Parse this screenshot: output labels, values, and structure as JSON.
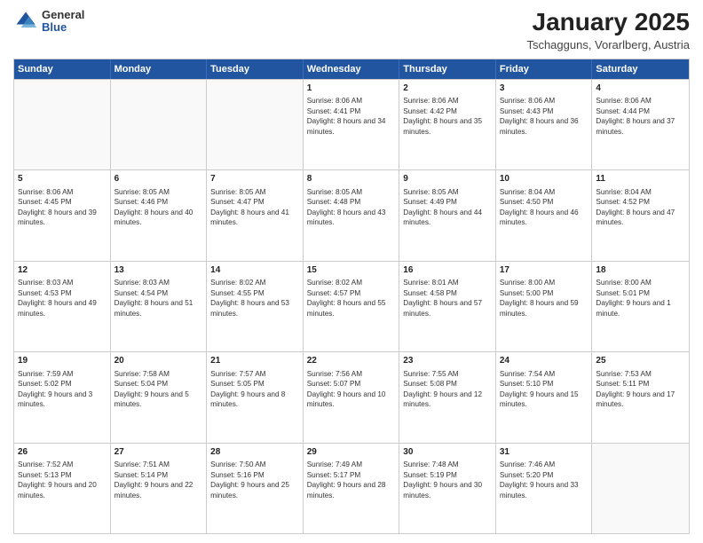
{
  "logo": {
    "general": "General",
    "blue": "Blue"
  },
  "title": "January 2025",
  "location": "Tschagguns, Vorarlberg, Austria",
  "weekdays": [
    "Sunday",
    "Monday",
    "Tuesday",
    "Wednesday",
    "Thursday",
    "Friday",
    "Saturday"
  ],
  "weeks": [
    [
      {
        "day": "",
        "sunrise": "",
        "sunset": "",
        "daylight": ""
      },
      {
        "day": "",
        "sunrise": "",
        "sunset": "",
        "daylight": ""
      },
      {
        "day": "",
        "sunrise": "",
        "sunset": "",
        "daylight": ""
      },
      {
        "day": "1",
        "sunrise": "Sunrise: 8:06 AM",
        "sunset": "Sunset: 4:41 PM",
        "daylight": "Daylight: 8 hours and 34 minutes."
      },
      {
        "day": "2",
        "sunrise": "Sunrise: 8:06 AM",
        "sunset": "Sunset: 4:42 PM",
        "daylight": "Daylight: 8 hours and 35 minutes."
      },
      {
        "day": "3",
        "sunrise": "Sunrise: 8:06 AM",
        "sunset": "Sunset: 4:43 PM",
        "daylight": "Daylight: 8 hours and 36 minutes."
      },
      {
        "day": "4",
        "sunrise": "Sunrise: 8:06 AM",
        "sunset": "Sunset: 4:44 PM",
        "daylight": "Daylight: 8 hours and 37 minutes."
      }
    ],
    [
      {
        "day": "5",
        "sunrise": "Sunrise: 8:06 AM",
        "sunset": "Sunset: 4:45 PM",
        "daylight": "Daylight: 8 hours and 39 minutes."
      },
      {
        "day": "6",
        "sunrise": "Sunrise: 8:05 AM",
        "sunset": "Sunset: 4:46 PM",
        "daylight": "Daylight: 8 hours and 40 minutes."
      },
      {
        "day": "7",
        "sunrise": "Sunrise: 8:05 AM",
        "sunset": "Sunset: 4:47 PM",
        "daylight": "Daylight: 8 hours and 41 minutes."
      },
      {
        "day": "8",
        "sunrise": "Sunrise: 8:05 AM",
        "sunset": "Sunset: 4:48 PM",
        "daylight": "Daylight: 8 hours and 43 minutes."
      },
      {
        "day": "9",
        "sunrise": "Sunrise: 8:05 AM",
        "sunset": "Sunset: 4:49 PM",
        "daylight": "Daylight: 8 hours and 44 minutes."
      },
      {
        "day": "10",
        "sunrise": "Sunrise: 8:04 AM",
        "sunset": "Sunset: 4:50 PM",
        "daylight": "Daylight: 8 hours and 46 minutes."
      },
      {
        "day": "11",
        "sunrise": "Sunrise: 8:04 AM",
        "sunset": "Sunset: 4:52 PM",
        "daylight": "Daylight: 8 hours and 47 minutes."
      }
    ],
    [
      {
        "day": "12",
        "sunrise": "Sunrise: 8:03 AM",
        "sunset": "Sunset: 4:53 PM",
        "daylight": "Daylight: 8 hours and 49 minutes."
      },
      {
        "day": "13",
        "sunrise": "Sunrise: 8:03 AM",
        "sunset": "Sunset: 4:54 PM",
        "daylight": "Daylight: 8 hours and 51 minutes."
      },
      {
        "day": "14",
        "sunrise": "Sunrise: 8:02 AM",
        "sunset": "Sunset: 4:55 PM",
        "daylight": "Daylight: 8 hours and 53 minutes."
      },
      {
        "day": "15",
        "sunrise": "Sunrise: 8:02 AM",
        "sunset": "Sunset: 4:57 PM",
        "daylight": "Daylight: 8 hours and 55 minutes."
      },
      {
        "day": "16",
        "sunrise": "Sunrise: 8:01 AM",
        "sunset": "Sunset: 4:58 PM",
        "daylight": "Daylight: 8 hours and 57 minutes."
      },
      {
        "day": "17",
        "sunrise": "Sunrise: 8:00 AM",
        "sunset": "Sunset: 5:00 PM",
        "daylight": "Daylight: 8 hours and 59 minutes."
      },
      {
        "day": "18",
        "sunrise": "Sunrise: 8:00 AM",
        "sunset": "Sunset: 5:01 PM",
        "daylight": "Daylight: 9 hours and 1 minute."
      }
    ],
    [
      {
        "day": "19",
        "sunrise": "Sunrise: 7:59 AM",
        "sunset": "Sunset: 5:02 PM",
        "daylight": "Daylight: 9 hours and 3 minutes."
      },
      {
        "day": "20",
        "sunrise": "Sunrise: 7:58 AM",
        "sunset": "Sunset: 5:04 PM",
        "daylight": "Daylight: 9 hours and 5 minutes."
      },
      {
        "day": "21",
        "sunrise": "Sunrise: 7:57 AM",
        "sunset": "Sunset: 5:05 PM",
        "daylight": "Daylight: 9 hours and 8 minutes."
      },
      {
        "day": "22",
        "sunrise": "Sunrise: 7:56 AM",
        "sunset": "Sunset: 5:07 PM",
        "daylight": "Daylight: 9 hours and 10 minutes."
      },
      {
        "day": "23",
        "sunrise": "Sunrise: 7:55 AM",
        "sunset": "Sunset: 5:08 PM",
        "daylight": "Daylight: 9 hours and 12 minutes."
      },
      {
        "day": "24",
        "sunrise": "Sunrise: 7:54 AM",
        "sunset": "Sunset: 5:10 PM",
        "daylight": "Daylight: 9 hours and 15 minutes."
      },
      {
        "day": "25",
        "sunrise": "Sunrise: 7:53 AM",
        "sunset": "Sunset: 5:11 PM",
        "daylight": "Daylight: 9 hours and 17 minutes."
      }
    ],
    [
      {
        "day": "26",
        "sunrise": "Sunrise: 7:52 AM",
        "sunset": "Sunset: 5:13 PM",
        "daylight": "Daylight: 9 hours and 20 minutes."
      },
      {
        "day": "27",
        "sunrise": "Sunrise: 7:51 AM",
        "sunset": "Sunset: 5:14 PM",
        "daylight": "Daylight: 9 hours and 22 minutes."
      },
      {
        "day": "28",
        "sunrise": "Sunrise: 7:50 AM",
        "sunset": "Sunset: 5:16 PM",
        "daylight": "Daylight: 9 hours and 25 minutes."
      },
      {
        "day": "29",
        "sunrise": "Sunrise: 7:49 AM",
        "sunset": "Sunset: 5:17 PM",
        "daylight": "Daylight: 9 hours and 28 minutes."
      },
      {
        "day": "30",
        "sunrise": "Sunrise: 7:48 AM",
        "sunset": "Sunset: 5:19 PM",
        "daylight": "Daylight: 9 hours and 30 minutes."
      },
      {
        "day": "31",
        "sunrise": "Sunrise: 7:46 AM",
        "sunset": "Sunset: 5:20 PM",
        "daylight": "Daylight: 9 hours and 33 minutes."
      },
      {
        "day": "",
        "sunrise": "",
        "sunset": "",
        "daylight": ""
      }
    ]
  ]
}
